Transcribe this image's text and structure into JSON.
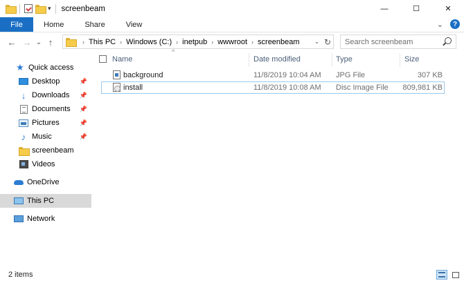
{
  "window": {
    "title": "screenbeam",
    "minimize_glyph": "—",
    "maximize_glyph": "☐",
    "close_glyph": "✕"
  },
  "quick_access_toolbar": {
    "dropdown_glyph": "▾",
    "icons": [
      "folder-icon",
      "properties-icon",
      "new-folder-icon",
      "customize-dropdown-icon"
    ]
  },
  "ribbon": {
    "tabs": [
      "File",
      "Home",
      "Share",
      "View"
    ],
    "expand_glyph": "⌄",
    "help_glyph": "?",
    "file_tab_color": "#1a6fc4"
  },
  "navigation": {
    "back_glyph": "←",
    "forward_glyph": "→",
    "recent_glyph": "⌄",
    "up_glyph": "↑",
    "breadcrumb_separator": "›",
    "breadcrumb": [
      "This PC",
      "Windows (C:)",
      "inetpub",
      "wwwroot",
      "screenbeam"
    ],
    "address_dropdown_glyph": "⌄",
    "refresh_glyph": "↻",
    "search_placeholder": "Search screenbeam"
  },
  "nav_pane": {
    "pin_glyph": "📌",
    "quick_access": "Quick access",
    "items": [
      {
        "label": "Desktop",
        "icon": "desktop-icon",
        "pinned": true
      },
      {
        "label": "Downloads",
        "icon": "downloads-icon",
        "pinned": true
      },
      {
        "label": "Documents",
        "icon": "documents-icon",
        "pinned": true
      },
      {
        "label": "Pictures",
        "icon": "pictures-icon",
        "pinned": true
      },
      {
        "label": "Music",
        "icon": "music-icon",
        "pinned": true
      },
      {
        "label": "screenbeam",
        "icon": "folder-icon",
        "pinned": false
      },
      {
        "label": "Videos",
        "icon": "videos-icon",
        "pinned": false
      }
    ],
    "onedrive": "OneDrive",
    "this_pc": "This PC",
    "network": "Network",
    "selected": "This PC"
  },
  "file_list": {
    "sort_glyph": "^",
    "columns": [
      "Name",
      "Date modified",
      "Type",
      "Size"
    ],
    "rows": [
      {
        "name": "background",
        "date_modified": "11/8/2019 10:04 AM",
        "type": "JPG File",
        "size": "307 KB",
        "icon": "image-file-icon",
        "selected": false
      },
      {
        "name": "install",
        "date_modified": "11/8/2019 10:08 AM",
        "type": "Disc Image File",
        "size": "809,981 KB",
        "icon": "disc-image-icon",
        "selected": true
      }
    ]
  },
  "status_bar": {
    "item_count": "2 items",
    "view_modes": [
      "details-view-icon",
      "large-icons-view-icon"
    ]
  }
}
